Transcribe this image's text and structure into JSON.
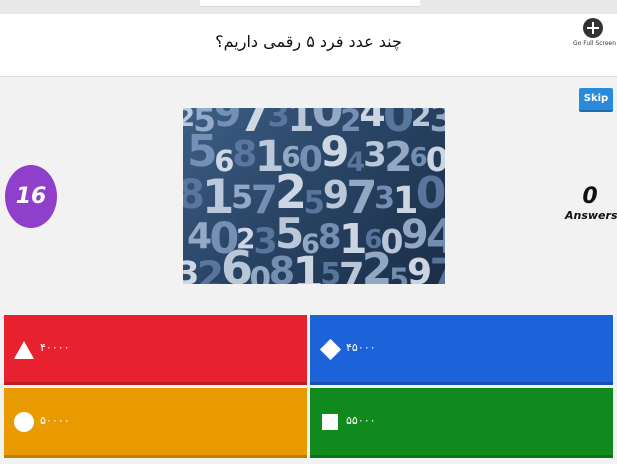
{
  "header": {
    "question": "چند عدد فرد ۵ رقمی داریم؟",
    "fullscreen_label": "Go Full Screen",
    "fullscreen_icon": "plus-circle-icon"
  },
  "skip_label": "Skip",
  "timer": "16",
  "answers": {
    "count": "0",
    "label": "Answers"
  },
  "media": {
    "digits": [
      "2",
      "5",
      "9",
      "7",
      "3",
      "1",
      "0",
      "2",
      "4",
      "0",
      "2",
      "3",
      "5",
      "6",
      "8",
      "1",
      "6",
      "0",
      "9",
      "4",
      "3",
      "2",
      "6",
      "0",
      "8",
      "1",
      "5",
      "7"
    ]
  },
  "choices": [
    {
      "shape": "triangle-icon",
      "text": "۴۰۰۰۰",
      "color": "#e8212f"
    },
    {
      "shape": "diamond-icon",
      "text": "۴۵۰۰۰",
      "color": "#1c62d9"
    },
    {
      "shape": "circle-icon",
      "text": "۵۰۰۰۰",
      "color": "#e89a00"
    },
    {
      "shape": "square-icon",
      "text": "۵۵۰۰۰",
      "color": "#108a1c"
    }
  ],
  "colors": {
    "timer": "#8f3fc9",
    "skip": "#2b8bd9"
  }
}
